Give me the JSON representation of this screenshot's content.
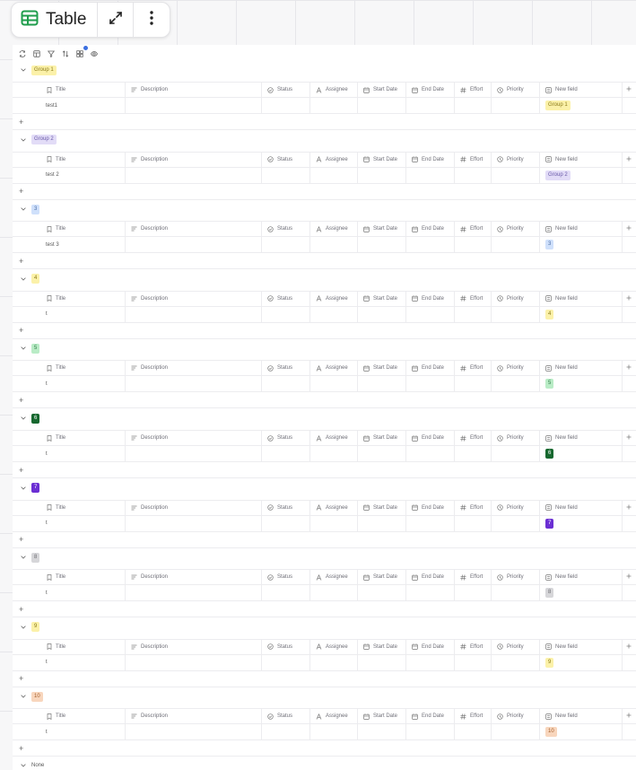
{
  "header": {
    "title": "Table",
    "colors": {
      "table_icon": "#1f9d4c"
    }
  },
  "toolbar": {
    "icons": [
      "refresh-icon",
      "layout-icon",
      "filter-icon",
      "sort-icon",
      "group-icon",
      "eye-icon"
    ]
  },
  "columns": [
    "Title",
    "Description",
    "Status",
    "Assignee",
    "Start Date",
    "End Date",
    "Effort",
    "Priority",
    "New field"
  ],
  "groups": [
    {
      "label": "Group 1",
      "bg": "#fbf1a9",
      "fg": "#8a7a19",
      "row_title": "test1",
      "field": "Group 1"
    },
    {
      "label": "Group 2",
      "bg": "#e2dcf7",
      "fg": "#6a5aa8",
      "row_title": "test 2",
      "field": "Group 2"
    },
    {
      "label": "3",
      "bg": "#cfe0fb",
      "fg": "#4d6fa8",
      "row_title": "test 3",
      "field": "3"
    },
    {
      "label": "4",
      "bg": "#fbf1a9",
      "fg": "#8a7a19",
      "row_title": "t",
      "field": "4"
    },
    {
      "label": "5",
      "bg": "#b9ecc6",
      "fg": "#2f7d47",
      "row_title": "t",
      "field": "5"
    },
    {
      "label": "6",
      "bg": "#17682f",
      "fg": "#ffffff",
      "row_title": "t",
      "field": "6"
    },
    {
      "label": "7",
      "bg": "#6b2fd3",
      "fg": "#ffffff",
      "row_title": "t",
      "field": "7"
    },
    {
      "label": "8",
      "bg": "#d6d6d9",
      "fg": "#6b6b70",
      "row_title": "t",
      "field": "8"
    },
    {
      "label": "9",
      "bg": "#fbf1a9",
      "fg": "#8a7a19",
      "row_title": "t",
      "field": "9"
    },
    {
      "label": "10",
      "bg": "#f8d6bd",
      "fg": "#a5622f",
      "row_title": "t",
      "field": "10"
    }
  ],
  "add_label": "+",
  "none_group": {
    "label": "None"
  }
}
